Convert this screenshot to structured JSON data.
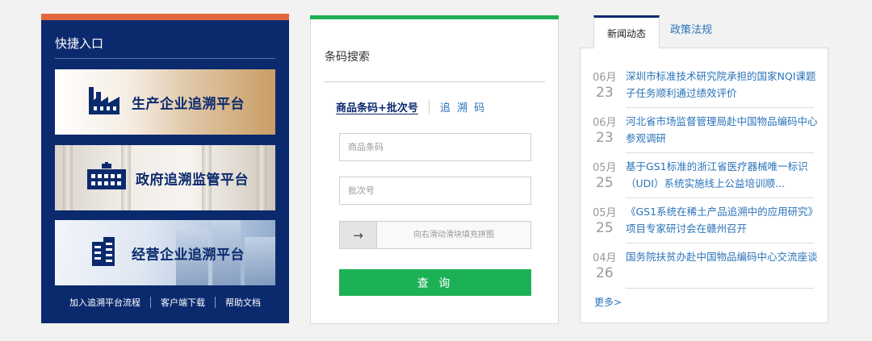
{
  "quick_entry": {
    "title": "快捷入口",
    "entries": [
      {
        "label": "生产企业追溯平台",
        "icon": "factory-icon"
      },
      {
        "label": "政府追溯监管平台",
        "icon": "government-building-icon"
      },
      {
        "label": "经营企业追溯平台",
        "icon": "office-building-icon"
      }
    ],
    "links": [
      "加入追溯平台流程",
      "客户端下载",
      "帮助文档"
    ],
    "colors": {
      "panel": "#0b2a6e",
      "accent": "#e2673d"
    }
  },
  "barcode_search": {
    "title": "条码搜索",
    "tab_active": "商品条码+批次号",
    "tab_other": "追 溯 码",
    "barcode_placeholder": "商品条码",
    "batch_placeholder": "批次号",
    "slider_icon": "→",
    "slider_hint": "向右滑动滑块填充拼图",
    "submit_label": "查 询",
    "colors": {
      "accent": "#1db155"
    }
  },
  "news": {
    "tab_active": "新闻动态",
    "tab_other": "政策法规",
    "items": [
      {
        "month": "06月",
        "day": "23",
        "title": "深圳市标准技术研究院承担的国家NQI课题子任务顺利通过绩效评价"
      },
      {
        "month": "06月",
        "day": "23",
        "title": "河北省市场监督管理局赴中国物品编码中心参观调研"
      },
      {
        "month": "05月",
        "day": "25",
        "title": "基于GS1标准的浙江省医疗器械唯一标识（UDI）系统实施线上公益培训顺..."
      },
      {
        "month": "05月",
        "day": "25",
        "title": "《GS1系统在稀土产品追溯中的应用研究》 项目专家研讨会在赣州召开"
      },
      {
        "month": "04月",
        "day": "26",
        "title": "国务院扶贫办赴中国物品编码中心交流座谈"
      }
    ],
    "more_label": "更多>",
    "colors": {
      "link": "#2a73b8"
    }
  }
}
